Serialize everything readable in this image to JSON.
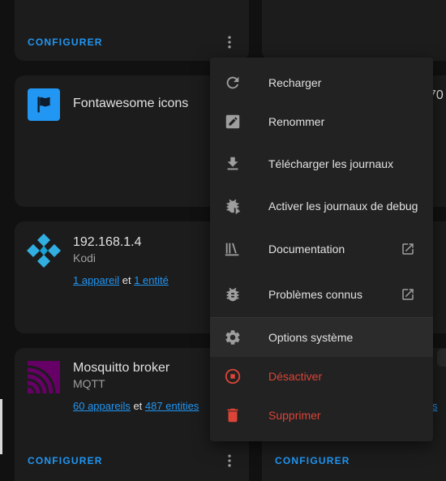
{
  "cards": {
    "top_left": {
      "configure_label": "CONFIGURER"
    },
    "fontawesome": {
      "title": "Fontawesome icons"
    },
    "kodi": {
      "title": "192.168.1.4",
      "subtitle": "Kodi",
      "devices_link": "1 appareil",
      "joiner": " et ",
      "entities_link": "1 entité"
    },
    "mosquitto": {
      "title": "Mosquitto broker",
      "subtitle": "MQTT",
      "devices_link": "60 appareils",
      "joiner": " et ",
      "entities_link": "487 entities",
      "configure_label": "CONFIGURER"
    },
    "right_partial": {
      "title_fragment": "70",
      "links_fragment": "s",
      "configure_label": "CONFIGURER"
    }
  },
  "menu": {
    "items": [
      {
        "label": "Recharger",
        "icon": "reload-icon"
      },
      {
        "label": "Renommer",
        "icon": "rename-icon"
      },
      {
        "label": "Télécharger les journaux",
        "icon": "download-icon"
      },
      {
        "label": "Activer les journaux de debug",
        "icon": "bug-play-icon"
      },
      {
        "label": "Documentation",
        "icon": "book-icon",
        "external": true
      },
      {
        "label": "Problèmes connus",
        "icon": "bug-icon",
        "external": true
      },
      {
        "label": "Options système",
        "icon": "gear-icon"
      },
      {
        "label": "Désactiver",
        "icon": "stop-circle-icon",
        "danger": true
      },
      {
        "label": "Supprimer",
        "icon": "trash-icon",
        "danger": true
      }
    ]
  },
  "colors": {
    "accent": "#2196f3",
    "danger": "#db4437",
    "fontawesome_icon_bg": "#2196f3",
    "kodi_blue": "#31afe1",
    "mqtt_purple": "#660066"
  }
}
